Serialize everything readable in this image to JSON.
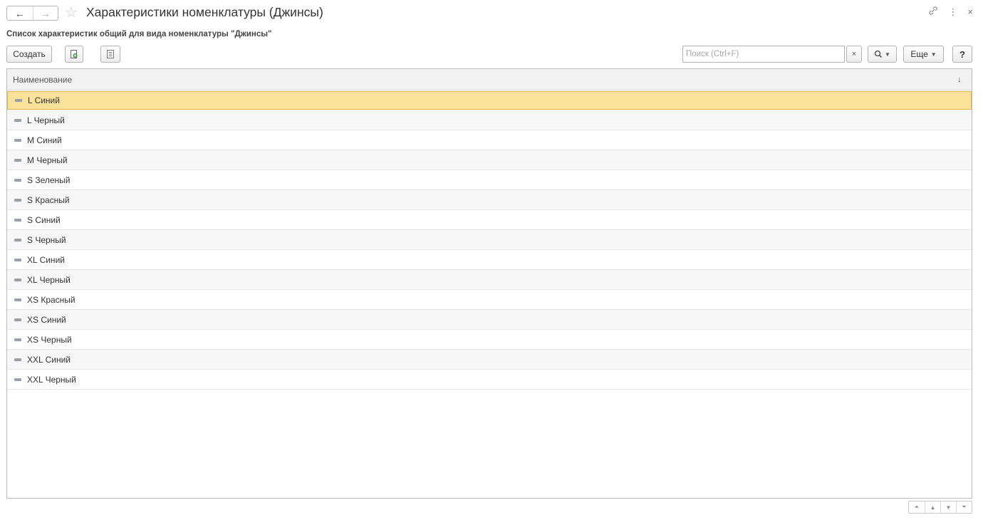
{
  "window": {
    "title": "Характеристики номенклатуры (Джинсы)",
    "back_icon": "←",
    "forward_icon": "→",
    "star_icon": "☆",
    "link_icon": "🔗",
    "menu_icon": "⋮",
    "close_icon": "×"
  },
  "subtitle": "Список характеристик общий для вида номенклатуры \"Джинсы\"",
  "toolbar": {
    "create_label": "Создать",
    "search_placeholder": "Поиск (Ctrl+F)",
    "clear_label": "×",
    "search_icon": "🔍",
    "more_label": "Еще",
    "help_label": "?"
  },
  "table": {
    "column_header": "Наименование",
    "sort_indicator": "↓",
    "selected_index": 0,
    "rows": [
      "L Синий",
      "L Черный",
      "M Синий",
      "M Черный",
      "S Зеленый",
      "S Красный",
      "S Синий",
      "S Черный",
      "XL Синий",
      "XL Черный",
      "XS Красный",
      "XS Синий",
      "XS Черный",
      "XXL Синий",
      "XXL Черный"
    ]
  },
  "colors": {
    "selected_row_bg": "#fbe29a",
    "selected_row_border": "#e2b74a"
  }
}
